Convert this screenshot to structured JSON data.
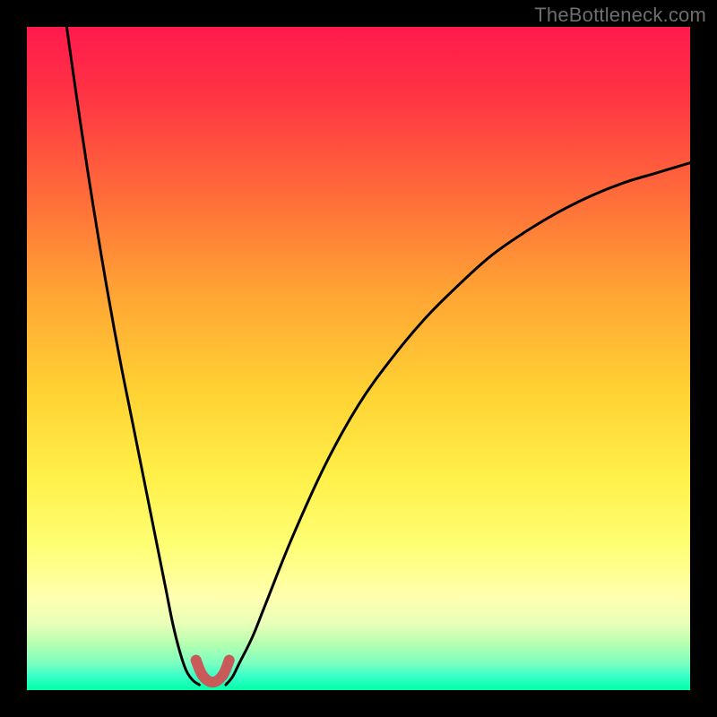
{
  "watermark": {
    "text": "TheBottleneck.com"
  },
  "colors": {
    "curve_stroke": "#000000",
    "marker_stroke": "#c85a5a",
    "marker_fill": "#c85a5a"
  },
  "chart_data": {
    "type": "line",
    "title": "",
    "xlabel": "",
    "ylabel": "",
    "xlim": [
      0,
      100
    ],
    "ylim": [
      0,
      100
    ],
    "grid": false,
    "series": [
      {
        "name": "left-branch",
        "x": [
          6,
          8,
          10,
          12,
          14,
          16,
          18,
          20,
          21,
          22,
          23,
          24,
          25,
          26
        ],
        "y": [
          100,
          86,
          73,
          61,
          50,
          40,
          30,
          20,
          15,
          10,
          6,
          3,
          1.5,
          0.8
        ]
      },
      {
        "name": "right-branch",
        "x": [
          30,
          31,
          32,
          34,
          36,
          40,
          45,
          50,
          55,
          60,
          65,
          70,
          75,
          80,
          85,
          90,
          95,
          100
        ],
        "y": [
          0.8,
          2,
          4,
          8,
          13,
          23,
          34,
          43,
          50,
          56,
          61,
          65.5,
          69,
          72,
          74.5,
          76.5,
          78,
          79.5
        ]
      }
    ],
    "markers": {
      "name": "optimum-region",
      "points": [
        {
          "x": 25.5,
          "y": 4.5
        },
        {
          "x": 26.5,
          "y": 2.2
        },
        {
          "x": 28.0,
          "y": 1.2
        },
        {
          "x": 29.5,
          "y": 2.2
        },
        {
          "x": 30.5,
          "y": 4.5
        }
      ],
      "radius_px": 6
    }
  }
}
